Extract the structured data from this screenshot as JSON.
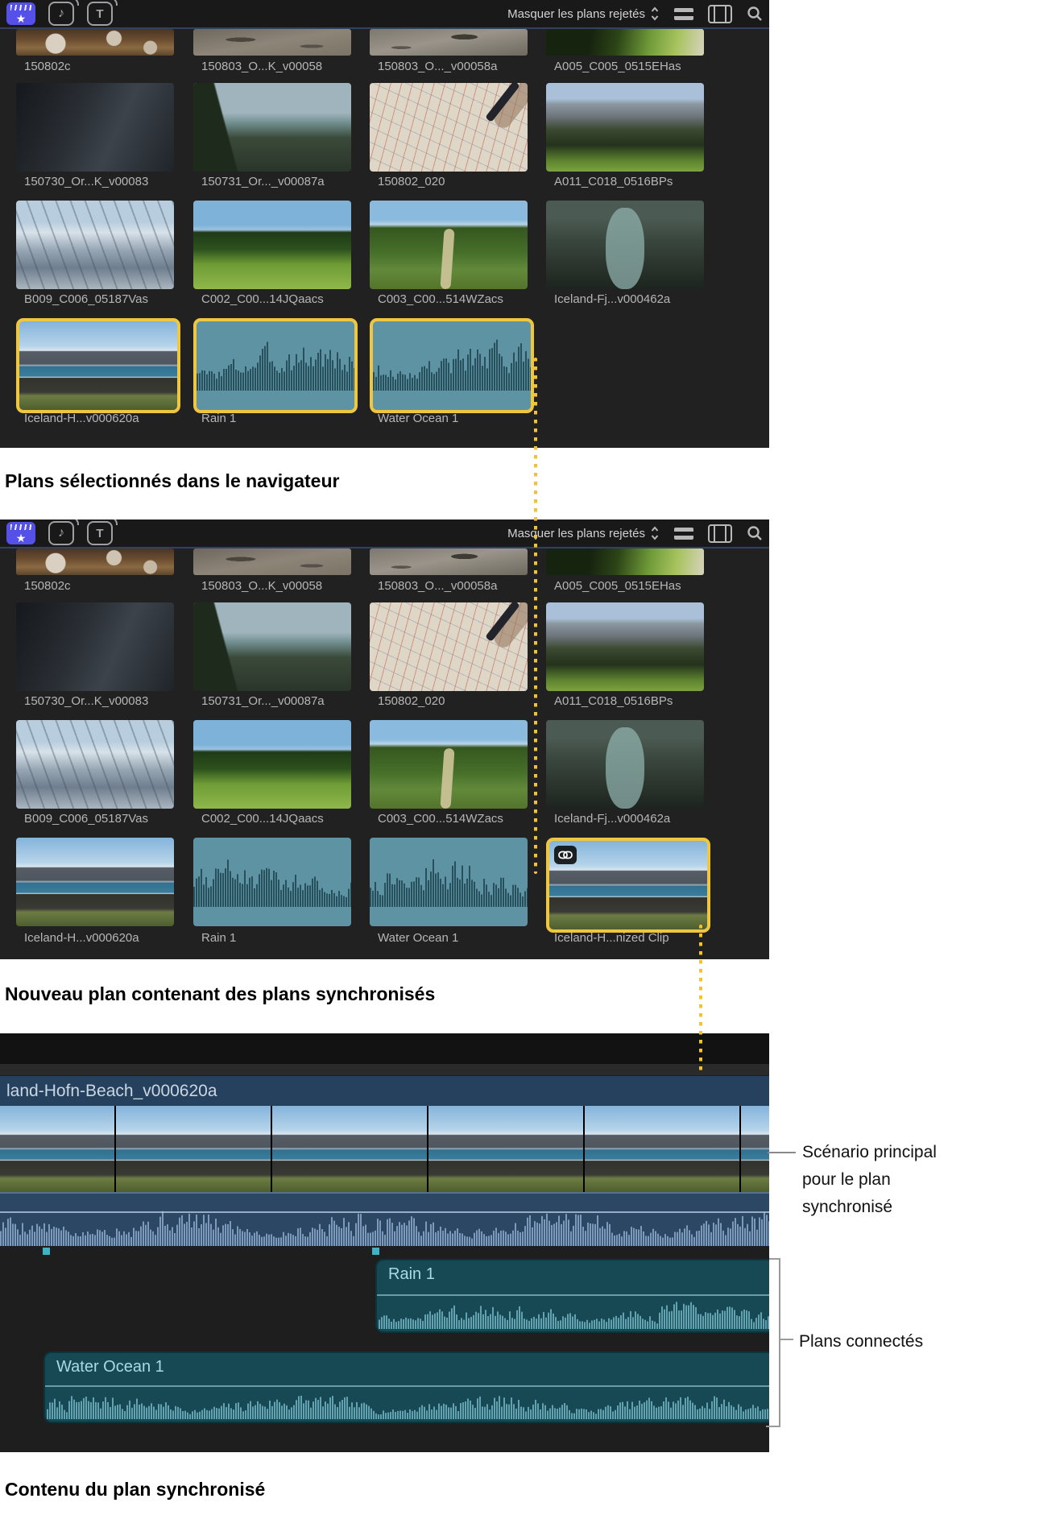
{
  "colors": {
    "selection_yellow": "#EFC63F",
    "dotted_line_yellow": "#F2C230",
    "clips_icon_blue": "#5450E8",
    "audio_clip_teal": "#5E93A3",
    "timeline_clip_teal": "#164953",
    "primary_storyline_blue": "#26415D"
  },
  "browser_toolbar": {
    "filter_label": "Masquer les plans rejetés",
    "left_icons": [
      "clips-filmstrip-star",
      "photos-audio-note",
      "titles-generators-t"
    ],
    "right_icons": [
      "clip-appearance-lines",
      "film-index",
      "search"
    ]
  },
  "browser_grid": {
    "row0": [
      "150802c",
      "150803_O...K_v00058",
      "150803_O..._v00058a",
      "A005_C005_0515EHas"
    ],
    "row1": [
      "150730_Or...K_v00083",
      "150731_Or..._v00087a",
      "150802_020",
      "A011_C018_0516BPs"
    ],
    "row2": [
      "B009_C006_05187Vas",
      "C002_C00...14JQaacs",
      "C003_C00...514WZacs",
      "Iceland-Fj...v000462a"
    ],
    "row3": [
      "Iceland-H...v000620a",
      "Rain 1",
      "Water Ocean 1",
      "Iceland-H...nized Clip"
    ]
  },
  "captions": {
    "panel1": "Plans sélectionnés dans le navigateur",
    "panel2": "Nouveau plan contenant des plans synchronisés",
    "panel3": "Contenu du plan synchronisé"
  },
  "timeline": {
    "primary_clip_title": "land-Hofn-Beach_v000620a",
    "connected_clips": [
      "Rain 1",
      "Water Ocean 1"
    ]
  },
  "annotations": {
    "primary_storyline": "Scénario principal pour le plan synchronisé",
    "connected_clips": "Plans connectés"
  }
}
